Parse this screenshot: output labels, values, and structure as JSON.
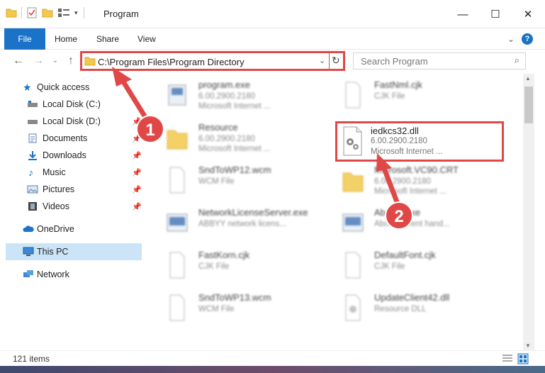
{
  "window": {
    "title": "Program",
    "controls": [
      "minimize-icon",
      "maximize-icon",
      "close-icon"
    ]
  },
  "ribbon": {
    "tabs": [
      "File",
      "Home",
      "Share",
      "View"
    ]
  },
  "address": {
    "path": "C:\\Program Files\\Program Directory"
  },
  "search": {
    "placeholder": "Search Program"
  },
  "sidebar": {
    "quick_access": "Quick access",
    "items": [
      {
        "label": "Local Disk (C:)",
        "pinned": false
      },
      {
        "label": "Local Disk (D:)",
        "pinned": true
      },
      {
        "label": "Documents",
        "pinned": true
      },
      {
        "label": "Downloads",
        "pinned": true
      },
      {
        "label": "Music",
        "pinned": true
      },
      {
        "label": "Pictures",
        "pinned": true
      },
      {
        "label": "Videos",
        "pinned": true
      }
    ],
    "onedrive": "OneDrive",
    "thispc": "This PC",
    "network": "Network"
  },
  "files": [
    {
      "name": "program.exe",
      "line2": "6.00.2900.2180",
      "line3": "Microsoft Internet ..."
    },
    {
      "name": "FastNml.cjk",
      "line2": "CJK File",
      "line3": ""
    },
    {
      "name": "Resource",
      "line2": "6.00.2900.2180",
      "line3": "Microsoft Internet ..."
    },
    {
      "name": "iedkcs32.dll",
      "line2": "6.00.2900.2180",
      "line3": "Microsoft Internet ..."
    },
    {
      "name": "SndToWP12.wcm",
      "line2": "WCM File",
      "line3": ""
    },
    {
      "name": "Microsoft.VC90.CRT",
      "line2": "6.00.2900.2180",
      "line3": "Microsoft Internet ..."
    },
    {
      "name": "NetworkLicenseServer.exe",
      "line2": "ABBYY network licens...",
      "line3": ""
    },
    {
      "name": "AboutT.exe",
      "line2": "AboutT event hand...",
      "line3": ""
    },
    {
      "name": "FastKorn.cjk",
      "line2": "CJK File",
      "line3": ""
    },
    {
      "name": "DefaultFont.cjk",
      "line2": "CJK File",
      "line3": ""
    },
    {
      "name": "SndToWP13.wcm",
      "line2": "WCM File",
      "line3": ""
    },
    {
      "name": "UpdateClient42.dll",
      "line2": "Resource DLL",
      "line3": ""
    }
  ],
  "annotations": {
    "badge1": "1",
    "badge2": "2"
  },
  "status": {
    "count": "121 items"
  },
  "colors": {
    "accent": "#1a73c8",
    "highlight": "#e04848"
  }
}
